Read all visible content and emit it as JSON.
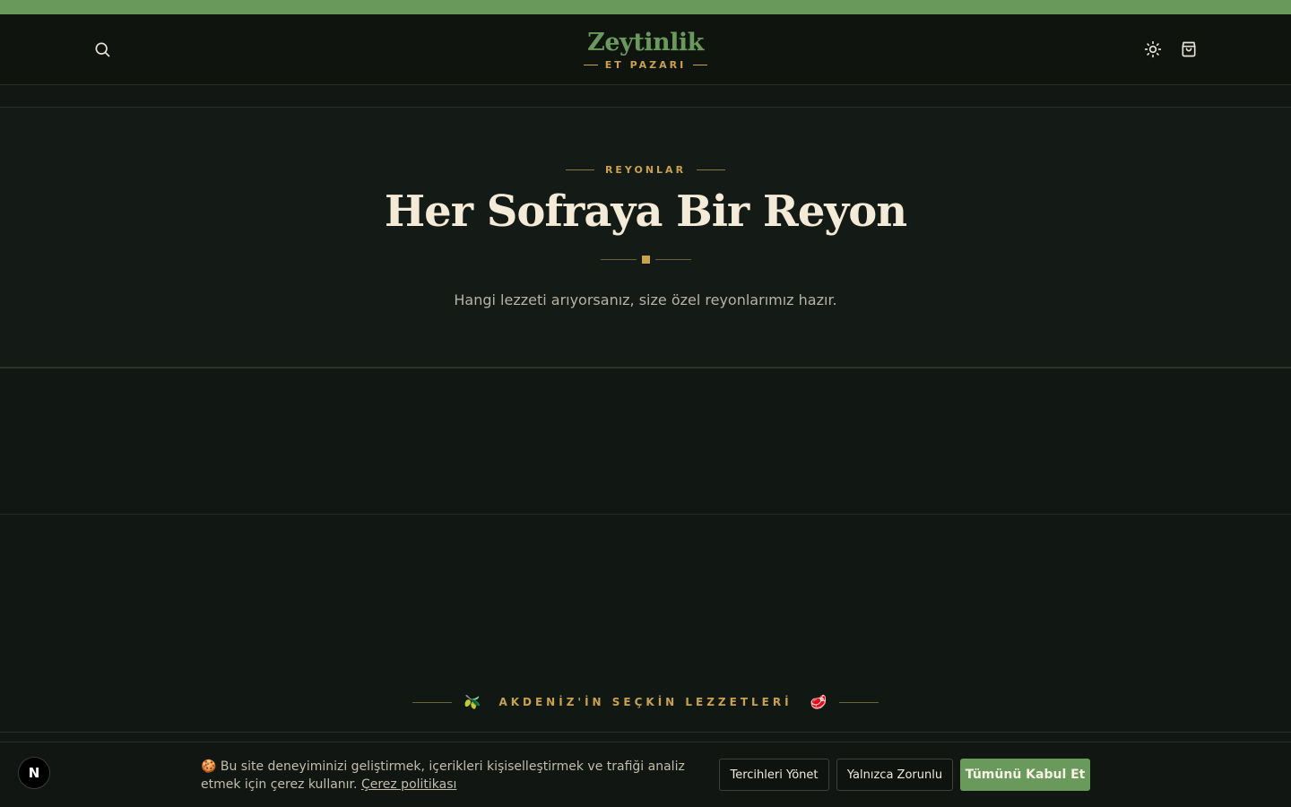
{
  "header": {
    "logo_name": "Zeytinlik",
    "logo_sub": "ET PAZARI",
    "icons": [
      "search-icon",
      "sun-icon",
      "shopping-bag-icon"
    ]
  },
  "hero": {
    "eyebrow": "REYONLAR",
    "title": "Her Sofraya Bir Reyon",
    "subtitle": "Hangi lezzeti arıyorsanız, size özel reyonlarımız hazır."
  },
  "tagline": {
    "left_emoji": "🫒",
    "text": "AKDENİZ'İN SEÇKİN LEZZETLERİ",
    "right_emoji": "🥩"
  },
  "cookie": {
    "text": "🍪 Bu site deneyiminizi geliştirmek, içerikleri kişiselleştirmek ve trafiği analiz etmek için çerez kullanır.",
    "policy_link": "Çerez politikası",
    "manage_label": "Tercihleri Yönet",
    "essential_label": "Yalnızca Zorunlu",
    "accept_label": "Tümünü Kabul Et"
  },
  "badge": {
    "letter": "N"
  },
  "colors": {
    "brand": "#6a9a5b",
    "gold": "#c9a24e",
    "background": "#121713",
    "title": "#f3ead7"
  }
}
